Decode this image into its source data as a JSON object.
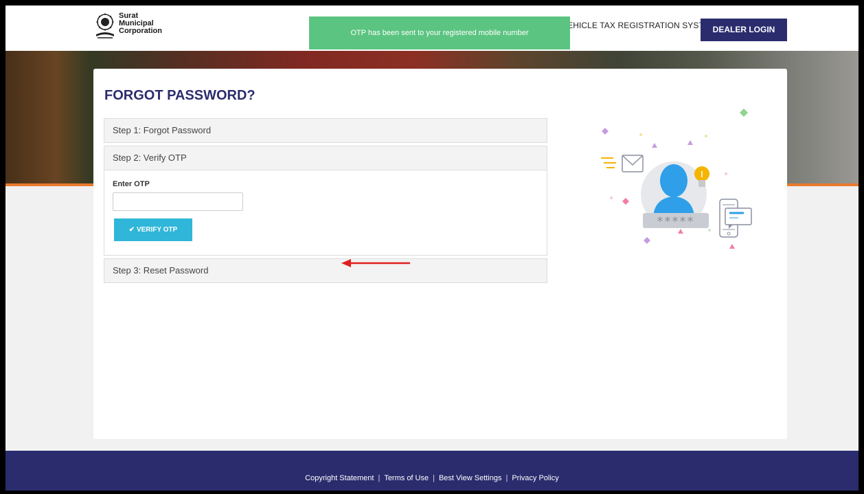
{
  "header": {
    "logo_lines": [
      "Surat",
      "Municipal",
      "Corporation"
    ],
    "system_title": "VEHICLE TAX REGISTRATION SYSTEM",
    "dealer_login": "DEALER LOGIN"
  },
  "toast": {
    "message": "OTP has been sent to your registered mobile number"
  },
  "form": {
    "title": "FORGOT PASSWORD?",
    "step1": "Step 1:  Forgot Password",
    "step2": "Step 2:  Verify OTP",
    "otp_label": "Enter OTP",
    "otp_value": "",
    "verify_label": "VERIFY OTP",
    "step3": "Step 3:  Reset Password"
  },
  "illustration": {
    "masked_password": "*****"
  },
  "footer": {
    "links": [
      "Copyright Statement",
      "Terms of Use",
      "Best View Settings",
      "Privacy Policy"
    ]
  },
  "colors": {
    "brand_navy": "#2b2c6e",
    "toast_green": "#5cc481",
    "button_cyan": "#2fb6d9",
    "accent_orange": "#e87a2c",
    "annotation_red": "#e02020"
  }
}
